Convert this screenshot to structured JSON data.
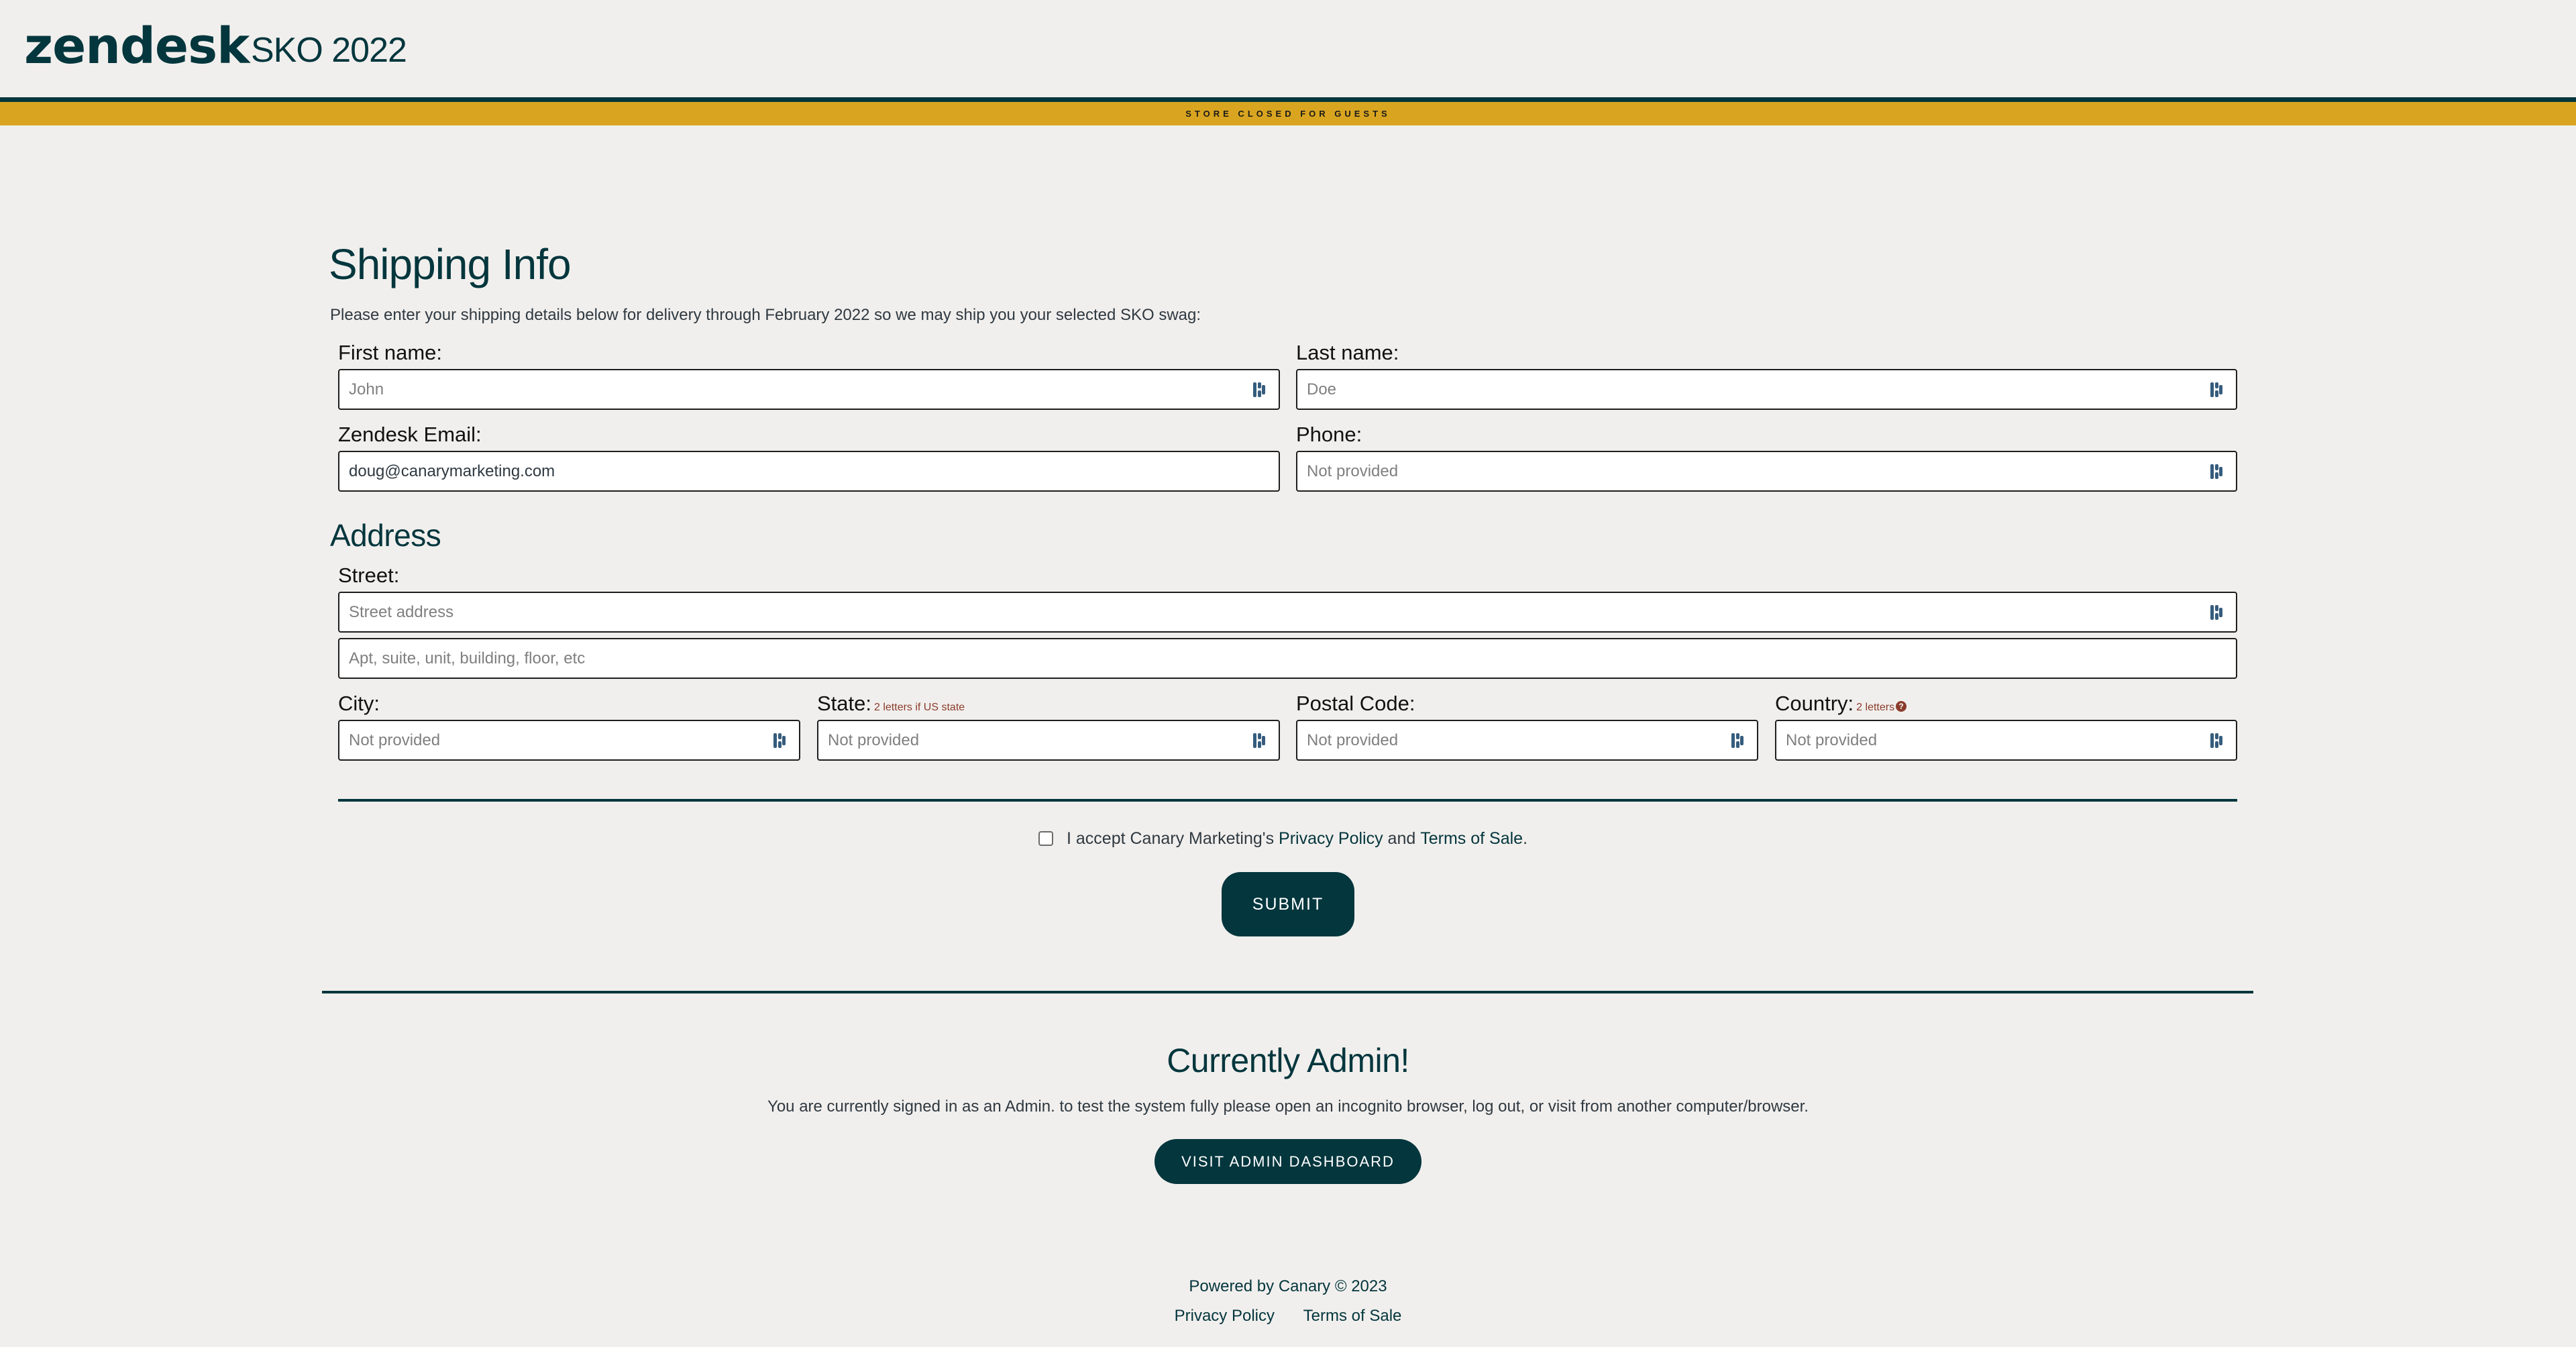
{
  "header": {
    "brand": "zendesk",
    "event_title": "SKO 2022",
    "banner_text": "STORE CLOSED FOR GUESTS"
  },
  "colors": {
    "primary": "#03363d",
    "banner": "#d9a520",
    "background": "#f1efed",
    "hint": "#8a3b2a"
  },
  "shipping": {
    "title": "Shipping Info",
    "description": "Please enter your shipping details below for delivery through February 2022 so we may ship you your selected SKO swag:",
    "first_name": {
      "label": "First name:",
      "value": "",
      "placeholder": "John",
      "icon": "password-manager-icon"
    },
    "last_name": {
      "label": "Last name:",
      "value": "",
      "placeholder": "Doe",
      "icon": "password-manager-icon"
    },
    "email": {
      "label": "Zendesk Email:",
      "value": "doug@canarymarketing.com",
      "placeholder": ""
    },
    "phone": {
      "label": "Phone:",
      "value": "",
      "placeholder": "Not provided",
      "icon": "password-manager-icon"
    }
  },
  "address": {
    "title": "Address",
    "street": {
      "label": "Street:",
      "placeholder": "Street address",
      "icon": "password-manager-icon"
    },
    "street2": {
      "placeholder": "Apt, suite, unit, building, floor, etc"
    },
    "city": {
      "label": "City:",
      "placeholder": "Not provided",
      "icon": "password-manager-icon"
    },
    "state": {
      "label": "State:",
      "hint": "2 letters if US state",
      "placeholder": "Not provided",
      "icon": "password-manager-icon"
    },
    "postal_code": {
      "label": "Postal Code:",
      "placeholder": "Not provided",
      "icon": "password-manager-icon"
    },
    "country": {
      "label": "Country:",
      "hint": "2 letters",
      "help_icon": "?",
      "placeholder": "Not provided",
      "icon": "password-manager-icon"
    }
  },
  "consent": {
    "checked": false,
    "prefix": "I accept Canary Marketing's ",
    "privacy_link": "Privacy Policy",
    "middle": " and ",
    "terms_link": "Terms of Sale",
    "suffix": "."
  },
  "submit_label": "SUBMIT",
  "admin": {
    "title": "Currently Admin!",
    "text": "You are currently signed in as an Admin. to test the system fully please open an incognito browser, log out, or visit from another computer/browser.",
    "button_label": "VISIT ADMIN DASHBOARD"
  },
  "footer": {
    "powered_by": "Powered by Canary © 2023",
    "links": [
      "Privacy Policy",
      "Terms of Sale"
    ]
  }
}
